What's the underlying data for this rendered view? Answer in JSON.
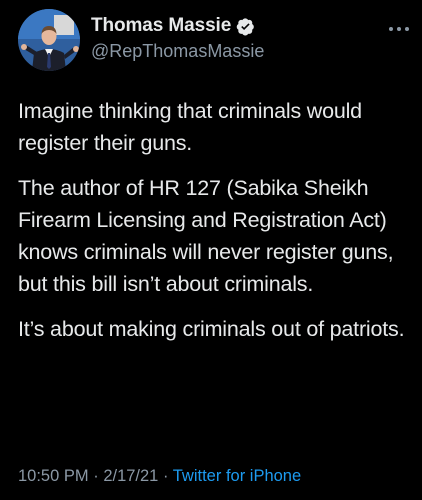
{
  "user": {
    "display_name": "Thomas Massie",
    "handle": "@RepThomasMassie",
    "verified": true
  },
  "tweet": {
    "paragraphs": [
      "Imagine thinking that criminals would register their guns.",
      "The author of HR 127 (Sabika Sheikh Firearm Licensing and Registration Act) knows criminals will never register guns, but this bill isn’t about criminals.",
      "It’s about making criminals out of patriots."
    ],
    "time": "10:50 PM",
    "separator": "·",
    "date": "2/17/21",
    "source": "Twitter for iPhone"
  },
  "icons": {
    "verified": "verified-badge-icon",
    "more": "more-options-icon"
  },
  "colors": {
    "background": "#000000",
    "text": "#e7e9ea",
    "secondary": "#8b98a5",
    "link": "#1d9bf0",
    "verified": "#1d9bf0"
  }
}
